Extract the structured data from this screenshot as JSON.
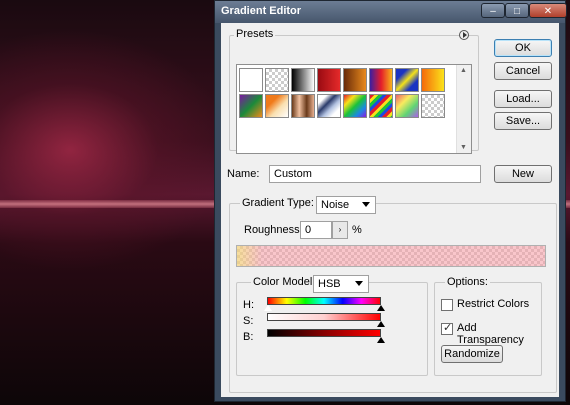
{
  "window": {
    "title": "Gradient Editor",
    "minimize_glyph": "–",
    "maximize_glyph": "□",
    "close_glyph": "✕"
  },
  "presets": {
    "label": "Presets",
    "swatches": [
      "white",
      "transparent-checker",
      "black-white",
      "red",
      "orange-brown",
      "violet-orange",
      "blue-yellow-blue",
      "orange-yellow",
      "violet-green-orange",
      "orange-transparent",
      "copper",
      "chrome",
      "spectrum",
      "rainbow-stripes",
      "transparent-rainbow",
      "transparent-stripes"
    ]
  },
  "buttons": {
    "ok": "OK",
    "cancel": "Cancel",
    "load": "Load...",
    "save": "Save...",
    "new": "New",
    "randomize": "Randomize"
  },
  "name": {
    "label": "Name:",
    "value": "Custom"
  },
  "gradient": {
    "type_label": "Gradient Type:",
    "type_value": "Noise",
    "roughness_label": "Roughness:",
    "roughness_value": "0",
    "roughness_unit": "%"
  },
  "color_model": {
    "label": "Color Model:",
    "value": "HSB",
    "channels": [
      {
        "label": "H:"
      },
      {
        "label": "S:"
      },
      {
        "label": "B:"
      }
    ]
  },
  "options": {
    "label": "Options:",
    "restrict_colors": {
      "label": "Restrict Colors",
      "checked": false
    },
    "add_transparency": {
      "label": "Add Transparency",
      "checked": true
    }
  },
  "colors": {
    "accent_blue": "#3c7fb1",
    "noise_pink": "#f5a0a8",
    "noise_yellow": "#f3d37a"
  }
}
